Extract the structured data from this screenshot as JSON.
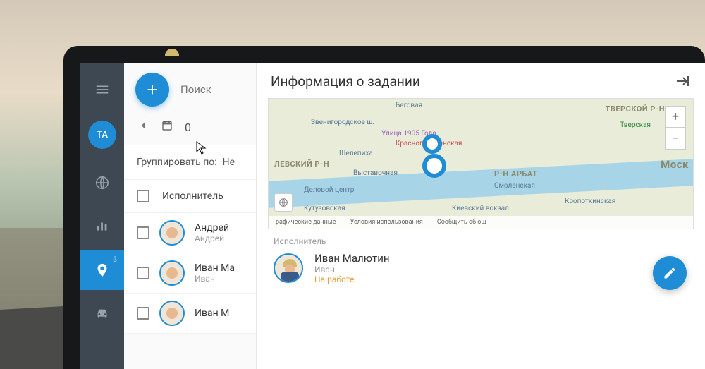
{
  "sidebar": {
    "avatar_initials": "ТА",
    "beta_badge": "β"
  },
  "list": {
    "search_placeholder": "Поиск",
    "date_value": "0",
    "group_by_label": "Группировать по:",
    "group_by_value": "Не",
    "column_header": "Исполнитель",
    "rows": [
      {
        "name": "Андрей",
        "sub": "Андрей",
        "hair": "brown"
      },
      {
        "name": "Иван Ма",
        "sub": "Иван",
        "hair": "blonde"
      },
      {
        "name": "Иван М",
        "sub": "",
        "hair": "blonde"
      }
    ]
  },
  "detail": {
    "title": "Информация о задании",
    "map": {
      "labels": {
        "begovaya": "Беговая",
        "zvenigorod": "Звенигородское ш.",
        "ulitsa1905": "Улица 1905 Года",
        "krasnopres": "Краснопресненская",
        "shelepikha": "Шелепиха",
        "vystavochnaya": "Выставочная",
        "delovoy": "Деловой центр",
        "kutuzov": "Кутузовская",
        "smolenskaya": "Смоленская",
        "kievsky": "Киевский вокзал",
        "kropotkin": "Кропоткинская",
        "tverskaya": "Тверская"
      },
      "districts": {
        "levsky": "ЛЕВСКИЙ Р-Н",
        "tversk": "ТВЕРСКОЙ Р-Н",
        "arbat": "Р-Н АРБАТ",
        "mosk": "Моск"
      },
      "footer": {
        "data": "рафические данные",
        "terms": "Условия использования",
        "report": "Сообщить об ош"
      }
    },
    "assignee": {
      "label": "Исполнитель",
      "name": "Иван Малютин",
      "sub": "Иван",
      "status": "На работе"
    }
  }
}
